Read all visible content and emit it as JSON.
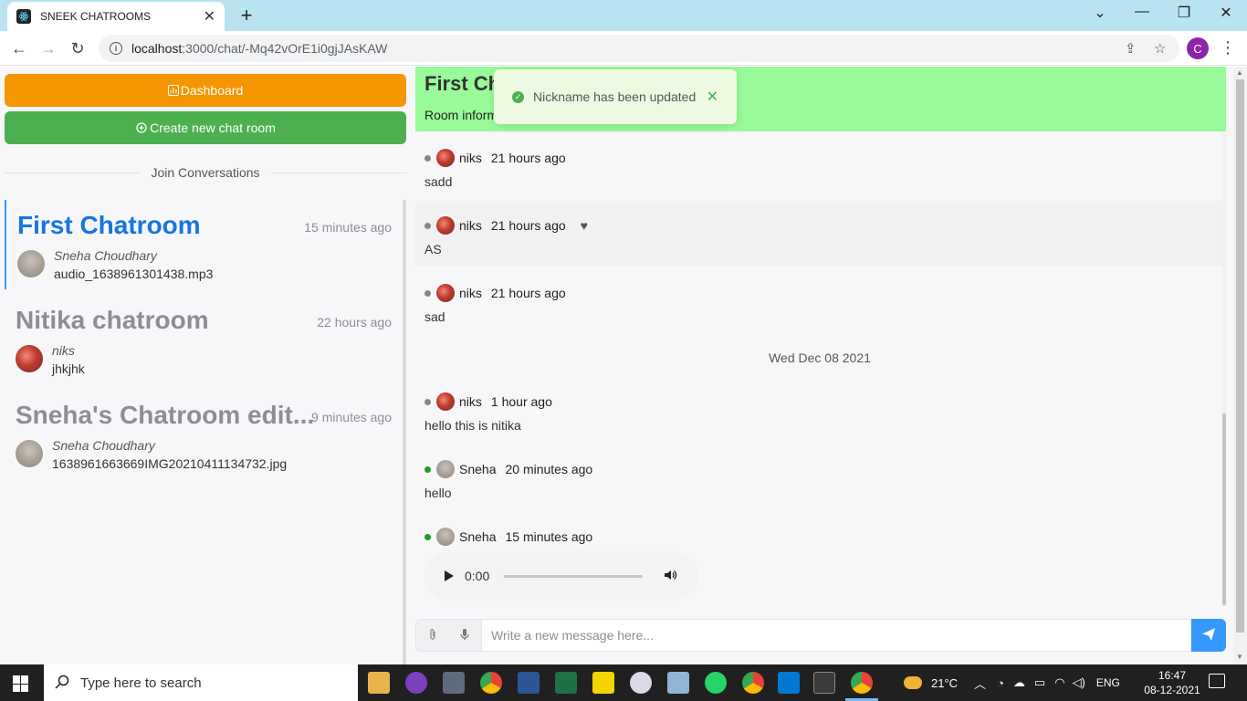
{
  "browser": {
    "tab_title": "SNEEK CHATROOMS",
    "url_host": "localhost",
    "url_rest": ":3000/chat/-Mq42vOrE1i0gjJAsKAW",
    "profile_initial": "C"
  },
  "sidebar": {
    "dashboard_label": "Dashboard",
    "create_label": "Create new chat room",
    "divider_label": "Join Conversations",
    "rooms": [
      {
        "name": "First Chatroom",
        "time": "15 minutes ago",
        "author": "Sneha Choudhary",
        "last": "audio_1638961301438.mp3"
      },
      {
        "name": "Nitika chatroom",
        "time": "22 hours ago",
        "author": "niks",
        "last": "jhkjhk"
      },
      {
        "name": "Sneha's Chatroom edit...",
        "time": "9 minutes ago",
        "author": "Sneha Choudhary",
        "last": "1638961663669IMG20210411134732.jpg"
      }
    ]
  },
  "chat": {
    "title": "First Ch",
    "info": "Room inform",
    "messages": [
      {
        "user": "niks",
        "time": "21 hours ago",
        "text": "sadd"
      },
      {
        "user": "niks",
        "time": "21 hours ago",
        "text": "AS"
      },
      {
        "user": "niks",
        "time": "21 hours ago",
        "text": "sad"
      },
      {
        "user": "niks",
        "time": "1 hour ago",
        "text": "hello this is nitika"
      },
      {
        "user": "Sneha",
        "time": "20 minutes ago",
        "text": "hello"
      },
      {
        "user": "Sneha",
        "time": "15 minutes ago",
        "text": ""
      }
    ],
    "date_separator": "Wed Dec 08 2021",
    "audio_time": "0:00",
    "input_placeholder": "Write a new message here..."
  },
  "toast": {
    "message": "Nickname has been updated"
  },
  "taskbar": {
    "search_placeholder": "Type here to search",
    "weather": "21°C",
    "lang": "ENG",
    "time": "16:47",
    "date": "08-12-2021"
  },
  "colors": {
    "dashboard": "#f59600",
    "create": "#4caf50",
    "header": "#99fa99",
    "active_room": "#1675e0",
    "send": "#3498ff"
  }
}
